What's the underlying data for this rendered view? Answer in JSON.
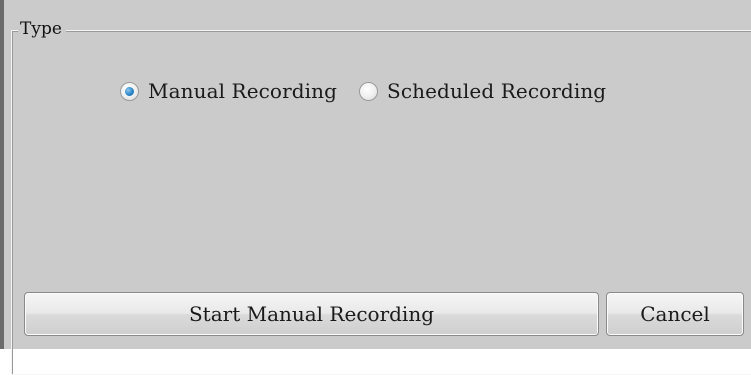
{
  "group": {
    "legend": "Type"
  },
  "recording_type": {
    "options": [
      {
        "label": "Manual Recording",
        "checked": true
      },
      {
        "label": "Scheduled Recording",
        "checked": false
      }
    ]
  },
  "buttons": {
    "start_label": "Start Manual Recording",
    "cancel_label": "Cancel"
  },
  "colors": {
    "panel_background": "#cbcbcb",
    "radio_selected": "#2a86c9"
  }
}
